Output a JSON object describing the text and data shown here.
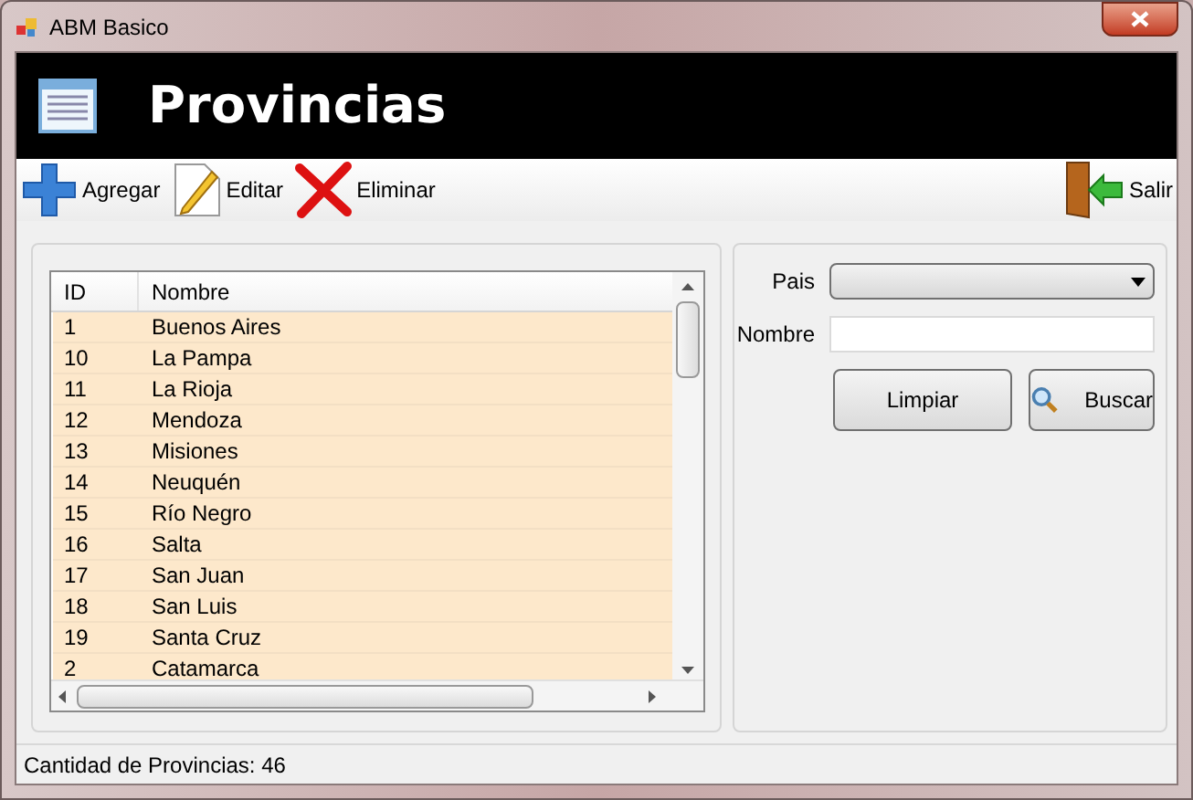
{
  "window": {
    "title": "ABM Basico"
  },
  "header": {
    "title": "Provincias"
  },
  "toolbar": [
    {
      "kind": "add",
      "label": "Agregar"
    },
    {
      "kind": "edit",
      "label": "Editar"
    },
    {
      "kind": "delete",
      "label": "Eliminar"
    },
    {
      "kind": "exit",
      "label": "Salir"
    }
  ],
  "table": {
    "columns": [
      "ID",
      "Nombre"
    ],
    "rows": [
      [
        "1",
        "Buenos Aires"
      ],
      [
        "10",
        "La Pampa"
      ],
      [
        "11",
        "La Rioja"
      ],
      [
        "12",
        "Mendoza"
      ],
      [
        "13",
        "Misiones"
      ],
      [
        "14",
        "Neuquén"
      ],
      [
        "15",
        "Río Negro"
      ],
      [
        "16",
        "Salta"
      ],
      [
        "17",
        "San Juan"
      ],
      [
        "18",
        "San Luis"
      ],
      [
        "19",
        "Santa Cruz"
      ],
      [
        "2",
        "Catamarca"
      ]
    ]
  },
  "filters": {
    "pais_label": "Pais",
    "nombre_label": "Nombre",
    "buttons": [
      {
        "kind": "clear",
        "label": "Limpiar"
      },
      {
        "kind": "search",
        "label": "Buscar"
      }
    ]
  },
  "status_bar": "Cantidad de Provincias: 46"
}
